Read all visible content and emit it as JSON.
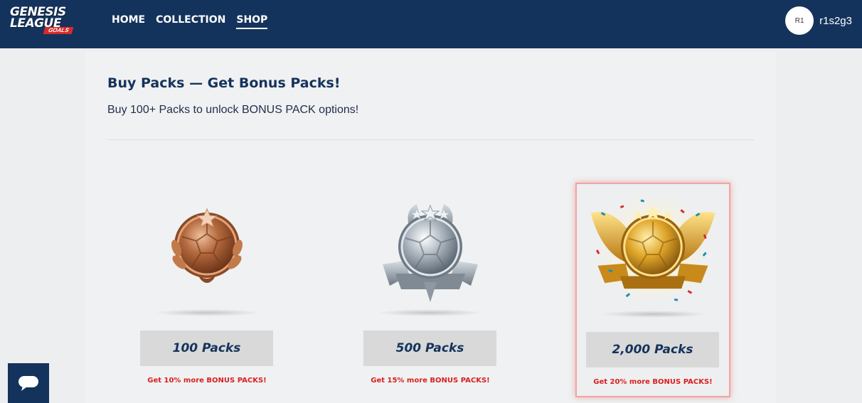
{
  "header": {
    "logo": {
      "line1": "GENESIS",
      "line2": "LEAGUE",
      "line3": "GOALS"
    },
    "nav": [
      {
        "label": "HOME",
        "active": false
      },
      {
        "label": "COLLECTION",
        "active": false
      },
      {
        "label": "SHOP",
        "active": true
      }
    ],
    "user": {
      "avatar_initials": "R1",
      "username": "r1s2g3"
    }
  },
  "main": {
    "title": "Buy Packs — Get Bonus Packs!",
    "subtitle": "Buy 100+ Packs to unlock BONUS PACK options!",
    "cards": [
      {
        "tier": "bronze",
        "button_label": "100 Packs",
        "bonus_text": "Get 10% more BONUS PACKS!",
        "featured": false
      },
      {
        "tier": "silver",
        "button_label": "500 Packs",
        "bonus_text": "Get 15% more BONUS PACKS!",
        "featured": false
      },
      {
        "tier": "gold",
        "button_label": "2,000 Packs",
        "bonus_text": "Get 20% more BONUS PACKS!",
        "featured": true
      }
    ]
  },
  "chat_widget": {
    "icon": "chat-icon"
  },
  "colors": {
    "header_bg": "#14335c",
    "accent_red": "#d92020",
    "button_bg": "#d9d9d9",
    "title_color": "#14335c"
  }
}
